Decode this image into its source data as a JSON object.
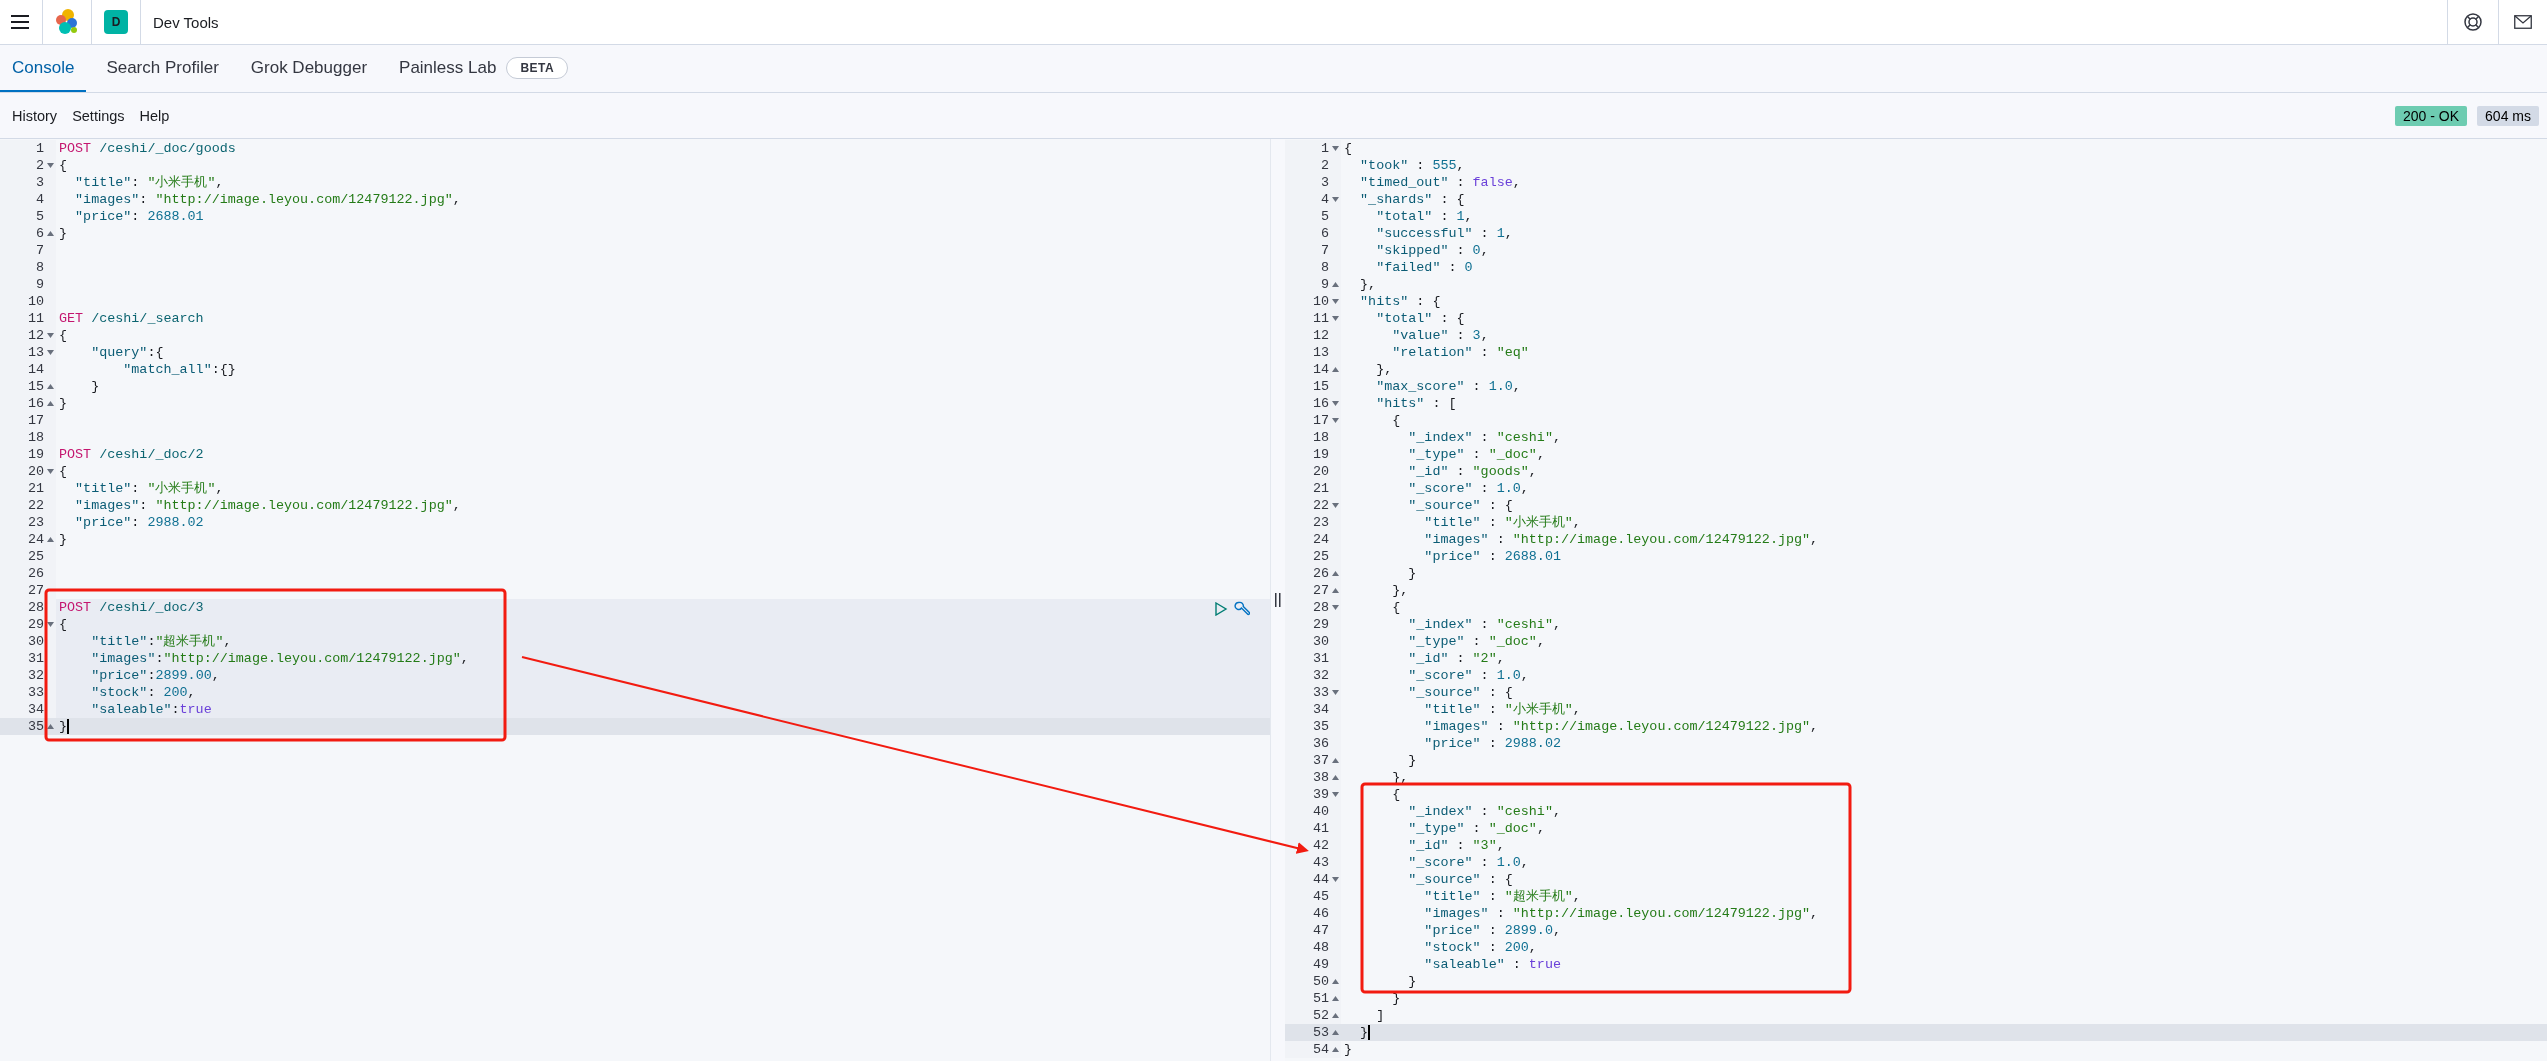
{
  "header": {
    "space_badge": "D",
    "title": "Dev Tools"
  },
  "tabs": [
    {
      "label": "Console",
      "selected": true
    },
    {
      "label": "Search Profiler",
      "selected": false
    },
    {
      "label": "Grok Debugger",
      "selected": false
    },
    {
      "label": "Painless Lab",
      "selected": false,
      "badge": "BETA"
    }
  ],
  "menu": [
    "History",
    "Settings",
    "Help"
  ],
  "status": {
    "code": "200 - OK",
    "time": "604 ms"
  },
  "request_editor": {
    "lines": [
      {
        "n": "1",
        "tokens": [
          {
            "kind": "method",
            "text": "POST"
          },
          {
            "kind": "url",
            "text": " /ceshi/_doc/goods"
          }
        ]
      },
      {
        "n": "2",
        "fold_start": true,
        "tokens": [
          {
            "kind": "punct",
            "text": "{"
          }
        ]
      },
      {
        "n": "3",
        "tokens": [
          {
            "kind": "key",
            "text": "  \"title\""
          },
          {
            "kind": "punct",
            "text": ": "
          },
          {
            "kind": "string",
            "text": "\"小米手机\""
          },
          {
            "kind": "punct",
            "text": ","
          }
        ]
      },
      {
        "n": "4",
        "tokens": [
          {
            "kind": "key",
            "text": "  \"images\""
          },
          {
            "kind": "punct",
            "text": ": "
          },
          {
            "kind": "string",
            "text": "\"http://image.leyou.com/12479122.jpg\""
          },
          {
            "kind": "punct",
            "text": ","
          }
        ]
      },
      {
        "n": "5",
        "tokens": [
          {
            "kind": "key",
            "text": "  \"price\""
          },
          {
            "kind": "punct",
            "text": ": "
          },
          {
            "kind": "number",
            "text": "2688.01"
          }
        ]
      },
      {
        "n": "6",
        "fold_end": true,
        "tokens": [
          {
            "kind": "punct",
            "text": "}"
          }
        ]
      },
      {
        "n": "7"
      },
      {
        "n": "8"
      },
      {
        "n": "9"
      },
      {
        "n": "10"
      },
      {
        "n": "11",
        "tokens": [
          {
            "kind": "method",
            "text": "GET"
          },
          {
            "kind": "url",
            "text": " /ceshi/_search"
          }
        ]
      },
      {
        "n": "12",
        "fold_start": true,
        "tokens": [
          {
            "kind": "punct",
            "text": "{"
          }
        ]
      },
      {
        "n": "13",
        "fold_start": true,
        "tokens": [
          {
            "kind": "key",
            "text": "    \"query\""
          },
          {
            "kind": "punct",
            "text": ":{"
          }
        ]
      },
      {
        "n": "14",
        "tokens": [
          {
            "kind": "key",
            "text": "        \"match_all\""
          },
          {
            "kind": "punct",
            "text": ":{}"
          }
        ]
      },
      {
        "n": "15",
        "fold_end": true,
        "tokens": [
          {
            "kind": "punct",
            "text": "    }"
          }
        ]
      },
      {
        "n": "16",
        "fold_end": true,
        "tokens": [
          {
            "kind": "punct",
            "text": "}"
          }
        ]
      },
      {
        "n": "17"
      },
      {
        "n": "18"
      },
      {
        "n": "19",
        "tokens": [
          {
            "kind": "method",
            "text": "POST"
          },
          {
            "kind": "url",
            "text": " /ceshi/_doc/2"
          }
        ]
      },
      {
        "n": "20",
        "fold_start": true,
        "tokens": [
          {
            "kind": "punct",
            "text": "{"
          }
        ]
      },
      {
        "n": "21",
        "tokens": [
          {
            "kind": "key",
            "text": "  \"title\""
          },
          {
            "kind": "punct",
            "text": ": "
          },
          {
            "kind": "string",
            "text": "\"小米手机\""
          },
          {
            "kind": "punct",
            "text": ","
          }
        ]
      },
      {
        "n": "22",
        "tokens": [
          {
            "kind": "key",
            "text": "  \"images\""
          },
          {
            "kind": "punct",
            "text": ": "
          },
          {
            "kind": "string",
            "text": "\"http://image.leyou.com/12479122.jpg\""
          },
          {
            "kind": "punct",
            "text": ","
          }
        ]
      },
      {
        "n": "23",
        "tokens": [
          {
            "kind": "key",
            "text": "  \"price\""
          },
          {
            "kind": "punct",
            "text": ": "
          },
          {
            "kind": "number",
            "text": "2988.02"
          }
        ]
      },
      {
        "n": "24",
        "fold_end": true,
        "tokens": [
          {
            "kind": "punct",
            "text": "}"
          }
        ]
      },
      {
        "n": "25"
      },
      {
        "n": "26"
      },
      {
        "n": "27"
      },
      {
        "n": "28",
        "active_request": true,
        "actions": true,
        "tokens": [
          {
            "kind": "method",
            "text": "POST"
          },
          {
            "kind": "url",
            "text": " /ceshi/_doc/3"
          }
        ]
      },
      {
        "n": "29",
        "active_request": true,
        "fold_start": true,
        "tokens": [
          {
            "kind": "punct",
            "text": "{"
          }
        ]
      },
      {
        "n": "30",
        "active_request": true,
        "tokens": [
          {
            "kind": "key",
            "text": "    \"title\""
          },
          {
            "kind": "punct",
            "text": ":"
          },
          {
            "kind": "string",
            "text": "\"超米手机\""
          },
          {
            "kind": "punct",
            "text": ","
          }
        ]
      },
      {
        "n": "31",
        "active_request": true,
        "tokens": [
          {
            "kind": "key",
            "text": "    \"images\""
          },
          {
            "kind": "punct",
            "text": ":"
          },
          {
            "kind": "string",
            "text": "\"http://image.leyou.com/12479122.jpg\""
          },
          {
            "kind": "punct",
            "text": ","
          }
        ]
      },
      {
        "n": "32",
        "active_request": true,
        "tokens": [
          {
            "kind": "key",
            "text": "    \"price\""
          },
          {
            "kind": "punct",
            "text": ":"
          },
          {
            "kind": "number",
            "text": "2899.00"
          },
          {
            "kind": "punct",
            "text": ","
          }
        ]
      },
      {
        "n": "33",
        "active_request": true,
        "tokens": [
          {
            "kind": "key",
            "text": "    \"stock\""
          },
          {
            "kind": "punct",
            "text": ": "
          },
          {
            "kind": "number",
            "text": "200"
          },
          {
            "kind": "punct",
            "text": ","
          }
        ]
      },
      {
        "n": "34",
        "active_request": true,
        "tokens": [
          {
            "kind": "key",
            "text": "    \"saleable\""
          },
          {
            "kind": "punct",
            "text": ":"
          },
          {
            "kind": "bool",
            "text": "true"
          }
        ]
      },
      {
        "n": "35",
        "cursor": true,
        "fold_end": true,
        "tokens": [
          {
            "kind": "punct",
            "text": "}"
          }
        ]
      }
    ]
  },
  "response_viewer": {
    "lines": [
      {
        "n": "1",
        "fold_start": true,
        "tokens": [
          {
            "kind": "punct",
            "text": "{"
          }
        ]
      },
      {
        "n": "2",
        "tokens": [
          {
            "kind": "key",
            "text": "  \"took\""
          },
          {
            "kind": "punct",
            "text": " : "
          },
          {
            "kind": "number",
            "text": "555"
          },
          {
            "kind": "punct",
            "text": ","
          }
        ]
      },
      {
        "n": "3",
        "tokens": [
          {
            "kind": "key",
            "text": "  \"timed_out\""
          },
          {
            "kind": "punct",
            "text": " : "
          },
          {
            "kind": "bool",
            "text": "false"
          },
          {
            "kind": "punct",
            "text": ","
          }
        ]
      },
      {
        "n": "4",
        "fold_start": true,
        "tokens": [
          {
            "kind": "key",
            "text": "  \"_shards\""
          },
          {
            "kind": "punct",
            "text": " : {"
          }
        ]
      },
      {
        "n": "5",
        "tokens": [
          {
            "kind": "key",
            "text": "    \"total\""
          },
          {
            "kind": "punct",
            "text": " : "
          },
          {
            "kind": "number",
            "text": "1"
          },
          {
            "kind": "punct",
            "text": ","
          }
        ]
      },
      {
        "n": "6",
        "tokens": [
          {
            "kind": "key",
            "text": "    \"successful\""
          },
          {
            "kind": "punct",
            "text": " : "
          },
          {
            "kind": "number",
            "text": "1"
          },
          {
            "kind": "punct",
            "text": ","
          }
        ]
      },
      {
        "n": "7",
        "tokens": [
          {
            "kind": "key",
            "text": "    \"skipped\""
          },
          {
            "kind": "punct",
            "text": " : "
          },
          {
            "kind": "number",
            "text": "0"
          },
          {
            "kind": "punct",
            "text": ","
          }
        ]
      },
      {
        "n": "8",
        "tokens": [
          {
            "kind": "key",
            "text": "    \"failed\""
          },
          {
            "kind": "punct",
            "text": " : "
          },
          {
            "kind": "number",
            "text": "0"
          }
        ]
      },
      {
        "n": "9",
        "fold_end": true,
        "tokens": [
          {
            "kind": "punct",
            "text": "  },"
          }
        ]
      },
      {
        "n": "10",
        "fold_start": true,
        "tokens": [
          {
            "kind": "key",
            "text": "  \"hits\""
          },
          {
            "kind": "punct",
            "text": " : {"
          }
        ]
      },
      {
        "n": "11",
        "fold_start": true,
        "tokens": [
          {
            "kind": "key",
            "text": "    \"total\""
          },
          {
            "kind": "punct",
            "text": " : {"
          }
        ]
      },
      {
        "n": "12",
        "tokens": [
          {
            "kind": "key",
            "text": "      \"value\""
          },
          {
            "kind": "punct",
            "text": " : "
          },
          {
            "kind": "number",
            "text": "3"
          },
          {
            "kind": "punct",
            "text": ","
          }
        ]
      },
      {
        "n": "13",
        "tokens": [
          {
            "kind": "key",
            "text": "      \"relation\""
          },
          {
            "kind": "punct",
            "text": " : "
          },
          {
            "kind": "string",
            "text": "\"eq\""
          }
        ]
      },
      {
        "n": "14",
        "fold_end": true,
        "tokens": [
          {
            "kind": "punct",
            "text": "    },"
          }
        ]
      },
      {
        "n": "15",
        "tokens": [
          {
            "kind": "key",
            "text": "    \"max_score\""
          },
          {
            "kind": "punct",
            "text": " : "
          },
          {
            "kind": "number",
            "text": "1.0"
          },
          {
            "kind": "punct",
            "text": ","
          }
        ]
      },
      {
        "n": "16",
        "fold_start": true,
        "tokens": [
          {
            "kind": "key",
            "text": "    \"hits\""
          },
          {
            "kind": "punct",
            "text": " : ["
          }
        ]
      },
      {
        "n": "17",
        "fold_start": true,
        "tokens": [
          {
            "kind": "punct",
            "text": "      {"
          }
        ]
      },
      {
        "n": "18",
        "tokens": [
          {
            "kind": "key",
            "text": "        \"_index\""
          },
          {
            "kind": "punct",
            "text": " : "
          },
          {
            "kind": "string",
            "text": "\"ceshi\""
          },
          {
            "kind": "punct",
            "text": ","
          }
        ]
      },
      {
        "n": "19",
        "tokens": [
          {
            "kind": "key",
            "text": "        \"_type\""
          },
          {
            "kind": "punct",
            "text": " : "
          },
          {
            "kind": "string",
            "text": "\"_doc\""
          },
          {
            "kind": "punct",
            "text": ","
          }
        ]
      },
      {
        "n": "20",
        "tokens": [
          {
            "kind": "key",
            "text": "        \"_id\""
          },
          {
            "kind": "punct",
            "text": " : "
          },
          {
            "kind": "string",
            "text": "\"goods\""
          },
          {
            "kind": "punct",
            "text": ","
          }
        ]
      },
      {
        "n": "21",
        "tokens": [
          {
            "kind": "key",
            "text": "        \"_score\""
          },
          {
            "kind": "punct",
            "text": " : "
          },
          {
            "kind": "number",
            "text": "1.0"
          },
          {
            "kind": "punct",
            "text": ","
          }
        ]
      },
      {
        "n": "22",
        "fold_start": true,
        "tokens": [
          {
            "kind": "key",
            "text": "        \"_source\""
          },
          {
            "kind": "punct",
            "text": " : {"
          }
        ]
      },
      {
        "n": "23",
        "tokens": [
          {
            "kind": "key",
            "text": "          \"title\""
          },
          {
            "kind": "punct",
            "text": " : "
          },
          {
            "kind": "string",
            "text": "\"小米手机\""
          },
          {
            "kind": "punct",
            "text": ","
          }
        ]
      },
      {
        "n": "24",
        "tokens": [
          {
            "kind": "key",
            "text": "          \"images\""
          },
          {
            "kind": "punct",
            "text": " : "
          },
          {
            "kind": "string",
            "text": "\"http://image.leyou.com/12479122.jpg\""
          },
          {
            "kind": "punct",
            "text": ","
          }
        ]
      },
      {
        "n": "25",
        "tokens": [
          {
            "kind": "key",
            "text": "          \"price\""
          },
          {
            "kind": "punct",
            "text": " : "
          },
          {
            "kind": "number",
            "text": "2688.01"
          }
        ]
      },
      {
        "n": "26",
        "fold_end": true,
        "tokens": [
          {
            "kind": "punct",
            "text": "        }"
          }
        ]
      },
      {
        "n": "27",
        "fold_end": true,
        "tokens": [
          {
            "kind": "punct",
            "text": "      },"
          }
        ]
      },
      {
        "n": "28",
        "fold_start": true,
        "tokens": [
          {
            "kind": "punct",
            "text": "      {"
          }
        ]
      },
      {
        "n": "29",
        "tokens": [
          {
            "kind": "key",
            "text": "        \"_index\""
          },
          {
            "kind": "punct",
            "text": " : "
          },
          {
            "kind": "string",
            "text": "\"ceshi\""
          },
          {
            "kind": "punct",
            "text": ","
          }
        ]
      },
      {
        "n": "30",
        "tokens": [
          {
            "kind": "key",
            "text": "        \"_type\""
          },
          {
            "kind": "punct",
            "text": " : "
          },
          {
            "kind": "string",
            "text": "\"_doc\""
          },
          {
            "kind": "punct",
            "text": ","
          }
        ]
      },
      {
        "n": "31",
        "tokens": [
          {
            "kind": "key",
            "text": "        \"_id\""
          },
          {
            "kind": "punct",
            "text": " : "
          },
          {
            "kind": "string",
            "text": "\"2\""
          },
          {
            "kind": "punct",
            "text": ","
          }
        ]
      },
      {
        "n": "32",
        "tokens": [
          {
            "kind": "key",
            "text": "        \"_score\""
          },
          {
            "kind": "punct",
            "text": " : "
          },
          {
            "kind": "number",
            "text": "1.0"
          },
          {
            "kind": "punct",
            "text": ","
          }
        ]
      },
      {
        "n": "33",
        "fold_start": true,
        "tokens": [
          {
            "kind": "key",
            "text": "        \"_source\""
          },
          {
            "kind": "punct",
            "text": " : {"
          }
        ]
      },
      {
        "n": "34",
        "tokens": [
          {
            "kind": "key",
            "text": "          \"title\""
          },
          {
            "kind": "punct",
            "text": " : "
          },
          {
            "kind": "string",
            "text": "\"小米手机\""
          },
          {
            "kind": "punct",
            "text": ","
          }
        ]
      },
      {
        "n": "35",
        "tokens": [
          {
            "kind": "key",
            "text": "          \"images\""
          },
          {
            "kind": "punct",
            "text": " : "
          },
          {
            "kind": "string",
            "text": "\"http://image.leyou.com/12479122.jpg\""
          },
          {
            "kind": "punct",
            "text": ","
          }
        ]
      },
      {
        "n": "36",
        "tokens": [
          {
            "kind": "key",
            "text": "          \"price\""
          },
          {
            "kind": "punct",
            "text": " : "
          },
          {
            "kind": "number",
            "text": "2988.02"
          }
        ]
      },
      {
        "n": "37",
        "fold_end": true,
        "tokens": [
          {
            "kind": "punct",
            "text": "        }"
          }
        ]
      },
      {
        "n": "38",
        "fold_end": true,
        "tokens": [
          {
            "kind": "punct",
            "text": "      },"
          }
        ]
      },
      {
        "n": "39",
        "fold_start": true,
        "tokens": [
          {
            "kind": "punct",
            "text": "      {"
          }
        ]
      },
      {
        "n": "40",
        "tokens": [
          {
            "kind": "key",
            "text": "        \"_index\""
          },
          {
            "kind": "punct",
            "text": " : "
          },
          {
            "kind": "string",
            "text": "\"ceshi\""
          },
          {
            "kind": "punct",
            "text": ","
          }
        ]
      },
      {
        "n": "41",
        "tokens": [
          {
            "kind": "key",
            "text": "        \"_type\""
          },
          {
            "kind": "punct",
            "text": " : "
          },
          {
            "kind": "string",
            "text": "\"_doc\""
          },
          {
            "kind": "punct",
            "text": ","
          }
        ]
      },
      {
        "n": "42",
        "tokens": [
          {
            "kind": "key",
            "text": "        \"_id\""
          },
          {
            "kind": "punct",
            "text": " : "
          },
          {
            "kind": "string",
            "text": "\"3\""
          },
          {
            "kind": "punct",
            "text": ","
          }
        ]
      },
      {
        "n": "43",
        "tokens": [
          {
            "kind": "key",
            "text": "        \"_score\""
          },
          {
            "kind": "punct",
            "text": " : "
          },
          {
            "kind": "number",
            "text": "1.0"
          },
          {
            "kind": "punct",
            "text": ","
          }
        ]
      },
      {
        "n": "44",
        "fold_start": true,
        "tokens": [
          {
            "kind": "key",
            "text": "        \"_source\""
          },
          {
            "kind": "punct",
            "text": " : {"
          }
        ]
      },
      {
        "n": "45",
        "tokens": [
          {
            "kind": "key",
            "text": "          \"title\""
          },
          {
            "kind": "punct",
            "text": " : "
          },
          {
            "kind": "string",
            "text": "\"超米手机\""
          },
          {
            "kind": "punct",
            "text": ","
          }
        ]
      },
      {
        "n": "46",
        "tokens": [
          {
            "kind": "key",
            "text": "          \"images\""
          },
          {
            "kind": "punct",
            "text": " : "
          },
          {
            "kind": "string",
            "text": "\"http://image.leyou.com/12479122.jpg\""
          },
          {
            "kind": "punct",
            "text": ","
          }
        ]
      },
      {
        "n": "47",
        "tokens": [
          {
            "kind": "key",
            "text": "          \"price\""
          },
          {
            "kind": "punct",
            "text": " : "
          },
          {
            "kind": "number",
            "text": "2899.0"
          },
          {
            "kind": "punct",
            "text": ","
          }
        ]
      },
      {
        "n": "48",
        "tokens": [
          {
            "kind": "key",
            "text": "          \"stock\""
          },
          {
            "kind": "punct",
            "text": " : "
          },
          {
            "kind": "number",
            "text": "200"
          },
          {
            "kind": "punct",
            "text": ","
          }
        ]
      },
      {
        "n": "49",
        "tokens": [
          {
            "kind": "key",
            "text": "          \"saleable\""
          },
          {
            "kind": "punct",
            "text": " : "
          },
          {
            "kind": "bool",
            "text": "true"
          }
        ]
      },
      {
        "n": "50",
        "fold_end": true,
        "tokens": [
          {
            "kind": "punct",
            "text": "        }"
          }
        ]
      },
      {
        "n": "51",
        "fold_end": true,
        "tokens": [
          {
            "kind": "punct",
            "text": "      }"
          }
        ]
      },
      {
        "n": "52",
        "fold_end": true,
        "tokens": [
          {
            "kind": "punct",
            "text": "    ]"
          }
        ]
      },
      {
        "n": "53",
        "cursor": true,
        "fold_end": true,
        "tokens": [
          {
            "kind": "punct",
            "text": "  }"
          }
        ]
      },
      {
        "n": "54",
        "fold_end": true,
        "tokens": [
          {
            "kind": "punct",
            "text": "}"
          }
        ]
      }
    ]
  }
}
